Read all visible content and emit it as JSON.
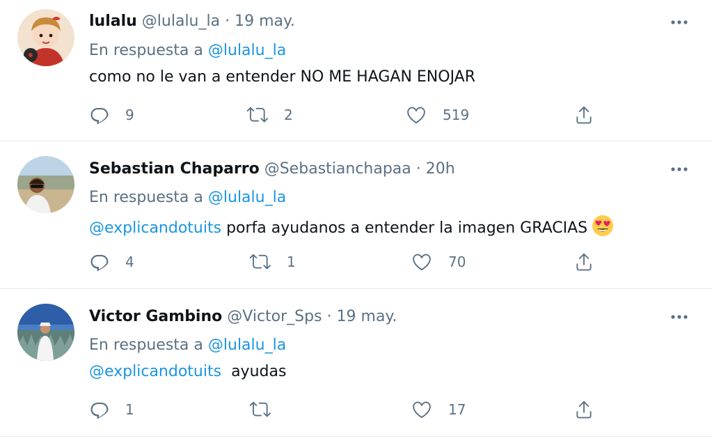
{
  "tweets": [
    {
      "name": "lulalu",
      "handle": "@lulalu_la",
      "separator": "·",
      "time": "19 may.",
      "reply_prefix": "En respuesta a",
      "reply_to": "@lulalu_la",
      "mention": "",
      "text": "como no le van a entender NO ME HAGAN ENOJAR",
      "replies": "9",
      "retweets": "2",
      "likes": "519",
      "avatar_icon": "girl-illustration-avatar"
    },
    {
      "name": "Sebastian Chaparro",
      "handle": "@Sebastianchapaa",
      "separator": "·",
      "time": "20h",
      "reply_prefix": "En respuesta a",
      "reply_to": "@lulalu_la",
      "mention": "@explicandotuits",
      "text": " porfa ayudanos a entender la imagen GRACIAS",
      "emoji": "heart-eyes-emoji",
      "replies": "4",
      "retweets": "1",
      "likes": "70",
      "avatar_icon": "man-with-sunglasses-avatar"
    },
    {
      "name": "Victor Gambino",
      "handle": "@Victor_Sps",
      "separator": "·",
      "time": "19 may.",
      "reply_prefix": "En respuesta a",
      "reply_to": "@lulalu_la",
      "mention": "@explicandotuits",
      "text": "  ayudas",
      "replies": "1",
      "retweets": "",
      "likes": "17",
      "avatar_icon": "man-in-agave-field-avatar"
    }
  ],
  "colors": {
    "text": "#0f1419",
    "secondary": "#5b7083",
    "link": "#1b95e0",
    "divider": "#e6ecf0"
  },
  "icons": [
    "more-icon",
    "reply-icon",
    "retweet-icon",
    "like-icon",
    "share-icon"
  ]
}
